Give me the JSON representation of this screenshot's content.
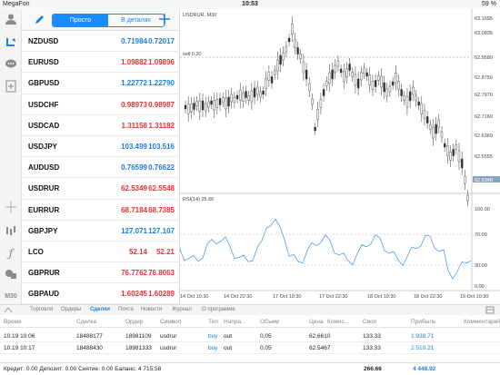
{
  "status": {
    "carrier": "MegaFon",
    "time": "10:53",
    "battery": "59 %"
  },
  "quotes_panel": {
    "tab_simple": "Просто",
    "tab_detailed": "В деталях"
  },
  "quotes": [
    {
      "symbol": "NZDUSD",
      "bid": "0.71984",
      "ask": "0.72017",
      "dir": "up"
    },
    {
      "symbol": "EURUSD",
      "bid": "1.09882",
      "ask": "1.09896",
      "dir": "dn"
    },
    {
      "symbol": "GBPUSD",
      "bid": "1.22772",
      "ask": "1.22790",
      "dir": "up"
    },
    {
      "symbol": "USDCHF",
      "bid": "0.98973",
      "ask": "0.98987",
      "dir": "dn"
    },
    {
      "symbol": "USDCAD",
      "bid": "1.31158",
      "ask": "1.31182",
      "dir": "dn"
    },
    {
      "symbol": "USDJPY",
      "bid": "103.499",
      "ask": "103.516",
      "dir": "up"
    },
    {
      "symbol": "AUDUSD",
      "bid": "0.76599",
      "ask": "0.76622",
      "dir": "up"
    },
    {
      "symbol": "USDRUR",
      "bid": "62.5349",
      "ask": "62.5548",
      "dir": "dn"
    },
    {
      "symbol": "EURRUR",
      "bid": "68.7184",
      "ask": "68.7385",
      "dir": "dn"
    },
    {
      "symbol": "GBPJPY",
      "bid": "127.071",
      "ask": "127.107",
      "dir": "up"
    },
    {
      "symbol": "LCO",
      "bid": "52.14",
      "ask": "52.21",
      "dir": "dn"
    },
    {
      "symbol": "GBPRUR",
      "bid": "76.7762",
      "ask": "76.8063",
      "dir": "dn"
    },
    {
      "symbol": "GBPAUD",
      "bid": "1.60245",
      "ask": "1.60289",
      "dir": "dn"
    },
    {
      "symbol": "EURGBP",
      "bid": "0.89485",
      "ask": "0.89506",
      "dir": "dn"
    }
  ],
  "left_toolbar": {
    "timeframe": "M30"
  },
  "chart": {
    "title": "USDRUR, M30",
    "sell_label": "sell 0.20",
    "price_ticks": [
      "63.1695",
      "63.0835",
      "62.9580",
      "62.8750",
      "62.7970",
      "62.7160",
      "62.6360",
      "62.5555"
    ],
    "last_price": "62.5348",
    "rsi_label": "RSI(14) 25.66",
    "rsi_ticks": [
      "100.00",
      "70.00",
      "30.00",
      "0.00"
    ],
    "time_ticks": [
      "14 Oct 10:30",
      "14 Oct 22:30",
      "17 Oct 10:30",
      "17 Oct 22:30",
      "18 Oct 10:30",
      "18 Oct 22:30",
      "19 Oct 10:30"
    ],
    "colors": {
      "price": "#333333",
      "rsi": "#3b8fe6",
      "dashed": "#888888"
    }
  },
  "tabs": [
    {
      "label": "Торговля",
      "active": false
    },
    {
      "label": "Ордеры",
      "active": false
    },
    {
      "label": "Сделки",
      "active": true
    },
    {
      "label": "Почта",
      "active": false
    },
    {
      "label": "Новости",
      "active": false
    },
    {
      "label": "Журнал",
      "active": false
    },
    {
      "label": "О программе",
      "active": false
    }
  ],
  "deals_header": [
    "Время",
    "Сделка",
    "Ордер",
    "Символ",
    "Тип",
    "Напра...",
    "Объем",
    "Цена",
    "Комис...",
    "Своп",
    "Прибыль",
    "Комментарий"
  ],
  "deals": [
    {
      "time": "10.19 10:06",
      "deal": "18488177",
      "order": "18981109",
      "symbol": "usdrur",
      "type": "buy",
      "dir": "out",
      "volume": "0.05",
      "price": "62.6610",
      "commission": "",
      "swap": "133.33",
      "profit": "1 938.71"
    },
    {
      "time": "10.19 10:17",
      "deal": "18488430",
      "order": "18981333",
      "symbol": "usdrur",
      "type": "buy",
      "dir": "out",
      "volume": "0.05",
      "price": "62.5467",
      "commission": "",
      "swap": "133.33",
      "profit": "2 510.21"
    }
  ],
  "footer": {
    "summary": "Кредит: 0.00 Депозит: 0.00 Снятие: 0.00 Баланс: 4 715.58",
    "swap_total": "266.66",
    "profit_total": "4 448.92"
  }
}
